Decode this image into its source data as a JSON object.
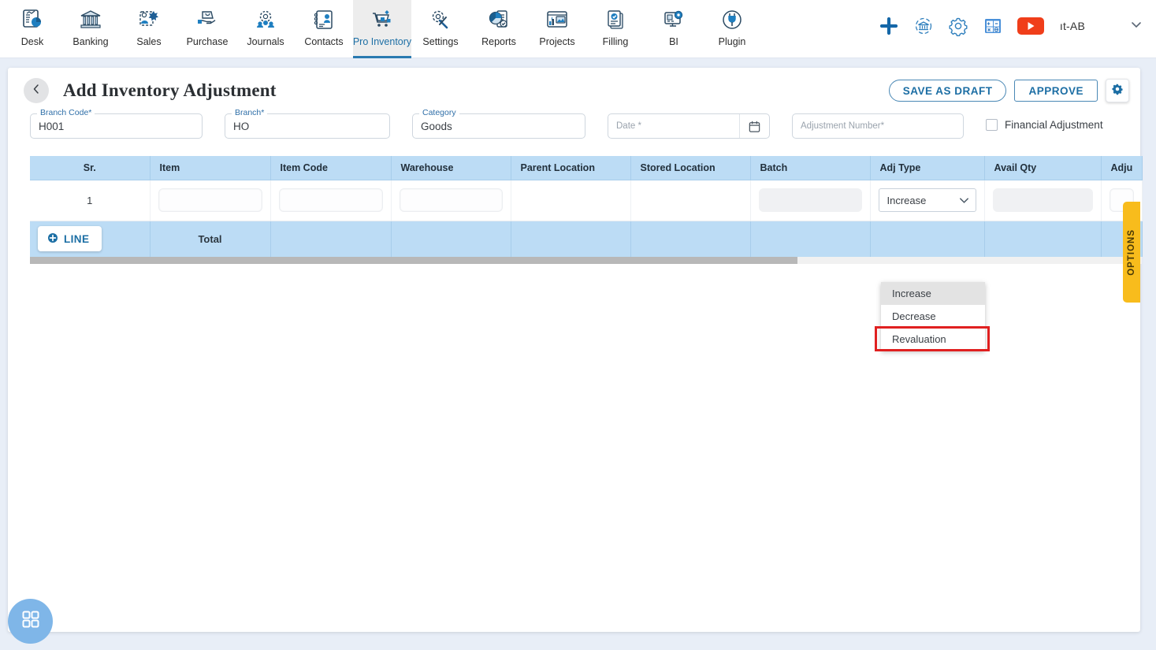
{
  "nav": {
    "items": [
      {
        "label": "Desk",
        "icon": "dashboard-icon",
        "active": false
      },
      {
        "label": "Banking",
        "icon": "bank-icon",
        "active": false
      },
      {
        "label": "Sales",
        "icon": "sales-icon",
        "active": false
      },
      {
        "label": "Purchase",
        "icon": "purchase-icon",
        "active": false
      },
      {
        "label": "Journals",
        "icon": "journals-icon",
        "active": false
      },
      {
        "label": "Contacts",
        "icon": "contacts-icon",
        "active": false
      },
      {
        "label": "Pro Inventory",
        "icon": "inventory-cart-icon",
        "active": true
      },
      {
        "label": "Settings",
        "icon": "settings-tools-icon",
        "active": false
      },
      {
        "label": "Reports",
        "icon": "reports-piechart-icon",
        "active": false
      },
      {
        "label": "Projects",
        "icon": "projects-icon",
        "active": false
      },
      {
        "label": "Filling",
        "icon": "filling-check-icon",
        "active": false
      },
      {
        "label": "BI",
        "icon": "bi-monitor-icon",
        "active": false
      },
      {
        "label": "Plugin",
        "icon": "plugin-icon",
        "active": false
      }
    ],
    "right": {
      "add_icon": "plus-icon",
      "bank_sync_icon": "bank-refresh-icon",
      "settings_icon": "gear-icon",
      "calculator_icon": "calculator-icon",
      "video_icon": "youtube-icon",
      "user_name": "ıt-AB",
      "chevron_icon": "chevron-down-icon"
    }
  },
  "header": {
    "back_icon": "chevron-left-icon",
    "title": "Add Inventory Adjustment",
    "save_draft_label": "SAVE AS DRAFT",
    "approve_label": "APPROVE",
    "settings_icon": "gear-icon"
  },
  "form": {
    "branch_code": {
      "label": "Branch Code",
      "required": "*",
      "value": "H001"
    },
    "branch": {
      "label": "Branch",
      "required": "*",
      "value": "HO"
    },
    "category": {
      "label": "Category",
      "required": "",
      "value": "Goods"
    },
    "date": {
      "placeholder": "Date *",
      "value": "",
      "calendar_icon": "calendar-icon"
    },
    "adjustment_number": {
      "placeholder": "Adjustment Number",
      "required": "*",
      "value": ""
    },
    "financial_adjustment": {
      "label": "Financial Adjustment",
      "checked": false
    }
  },
  "table": {
    "columns": [
      "Sr.",
      "Item",
      "Item Code",
      "Warehouse",
      "Parent Location",
      "Stored Location",
      "Batch",
      "Adj Type",
      "Avail Qty",
      "Adju"
    ],
    "rows": [
      {
        "sr": "1",
        "item": "",
        "item_code": "",
        "warehouse": "",
        "parent_location": "",
        "stored_location": "",
        "batch": "",
        "adj_type": "Increase",
        "avail_qty": "",
        "adjustment": ""
      }
    ],
    "footer": {
      "add_line_label": "LINE",
      "add_line_icon": "plus-circle-icon",
      "total_label": "Total"
    },
    "scroll_thumb_percent": 69
  },
  "adj_type_dropdown": {
    "open": true,
    "selected": "Increase",
    "options": [
      {
        "label": "Increase",
        "highlighted": true,
        "outlined": false
      },
      {
        "label": "Decrease",
        "highlighted": false,
        "outlined": false
      },
      {
        "label": "Revaluation",
        "highlighted": false,
        "outlined": true
      }
    ]
  },
  "options_tab": {
    "label": "OPTIONS",
    "color": "#f8bc1c"
  },
  "fab": {
    "icon": "grid-apps-icon",
    "color": "#7fb6e8"
  },
  "colors": {
    "accent": "#1c6ea4",
    "table_header": "#bcdcf5",
    "page_bg": "#e8eef7",
    "highlight_outline": "#e02020"
  }
}
